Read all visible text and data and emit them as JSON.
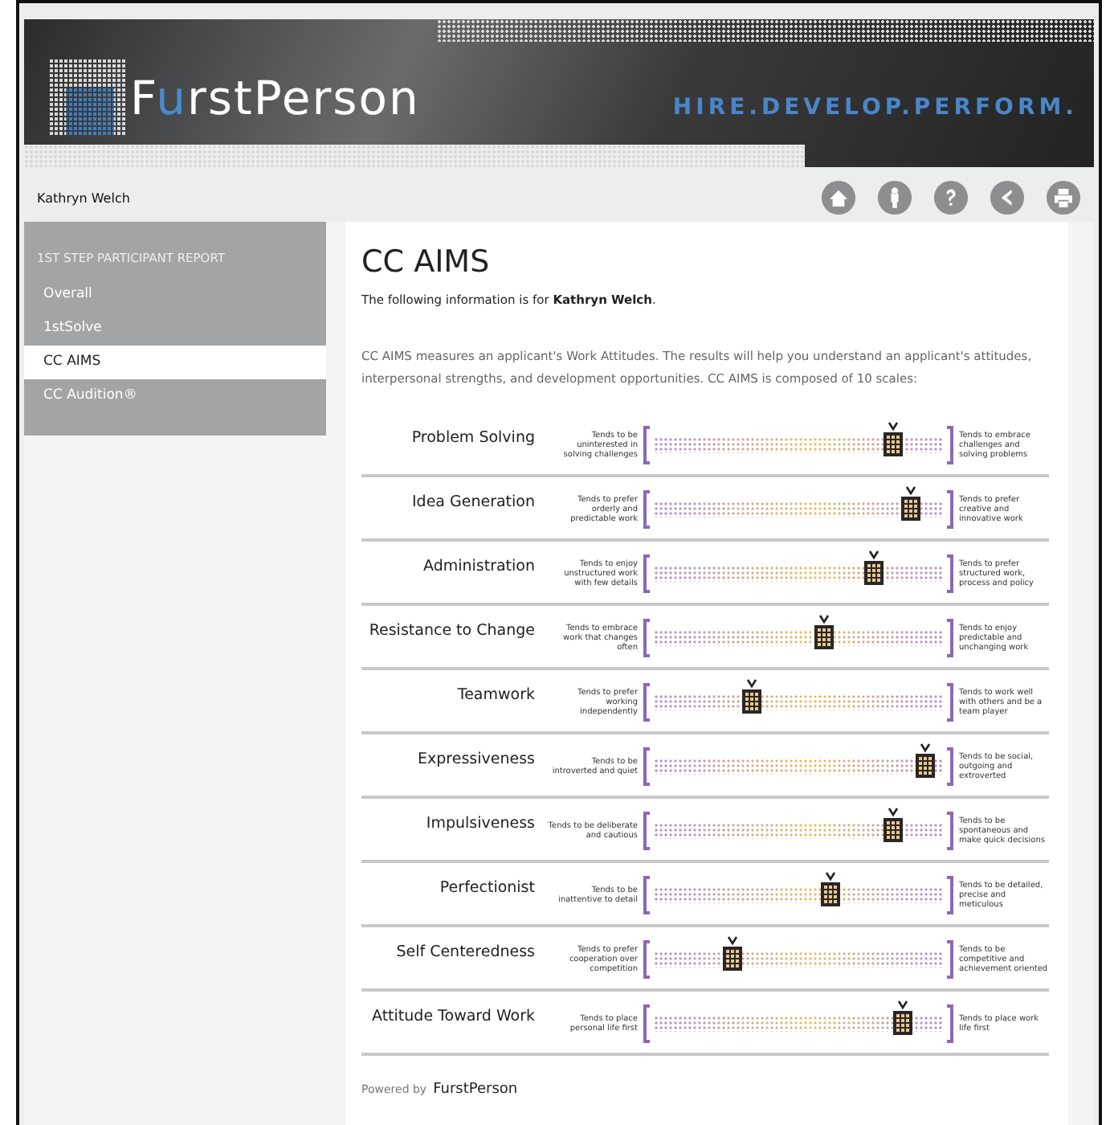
{
  "header": {
    "logo": [
      {
        "text": "F",
        "accent": false
      },
      {
        "text": "u",
        "accent": true
      },
      {
        "text": "rstPerson",
        "accent": false
      }
    ],
    "tagline": "HIRE.DEVELOP.PERFORM."
  },
  "user_bar": {
    "name": "Kathryn Welch",
    "icons": [
      {
        "kind": "home"
      },
      {
        "kind": "person"
      },
      {
        "kind": "help"
      },
      {
        "kind": "back"
      },
      {
        "kind": "print"
      }
    ]
  },
  "sidebar": {
    "heading": "1ST STEP PARTICIPANT REPORT",
    "items": [
      {
        "label": "Overall",
        "selected": false
      },
      {
        "label": "1stSolve",
        "selected": false
      },
      {
        "label": "CC AIMS",
        "selected": true
      },
      {
        "label": "CC Audition®",
        "selected": false
      }
    ]
  },
  "content": {
    "title": "CC AIMS",
    "intro": "The following information is for **Kathryn Welch**.",
    "description": "CC AIMS measures an applicant's Work Attitudes. The results will help you understand an applicant's attitudes, interpersonal strengths, and development opportunities. CC AIMS is composed of 10 scales:",
    "scales": [
      {
        "name": "Problem Solving",
        "low": "Tends to be uninterested in solving challenges",
        "high": "Tends to embrace challenges and solving problems",
        "level": 0.83
      },
      {
        "name": "Idea Generation",
        "low": "Tends to prefer orderly and predictable work",
        "high": "Tends to prefer creative and innovative work",
        "level": 0.89
      },
      {
        "name": "Administration",
        "low": "Tends to enjoy unstructured work with few details",
        "high": "Tends to prefer structured work, process and policy",
        "level": 0.76
      },
      {
        "name": "Resistance to Change",
        "low": "Tends to embrace work that changes often",
        "high": "Tends to enjoy predictable and unchanging work",
        "level": 0.59
      },
      {
        "name": "Teamwork",
        "low": "Tends to prefer working independently",
        "high": "Tends to work well with others and be a team player",
        "level": 0.34
      },
      {
        "name": "Expressiveness",
        "low": "Tends to be introverted and quiet",
        "high": "Tends to be social, outgoing and extroverted",
        "level": 0.94
      },
      {
        "name": "Impulsiveness",
        "low": "Tends to be deliberate and cautious",
        "high": "Tends to be spontaneous and make quick decisions",
        "level": 0.83
      },
      {
        "name": "Perfectionist",
        "low": "Tends to be inattentive to detail",
        "high": "Tends to be detailed, precise and meticulous",
        "level": 0.61
      },
      {
        "name": "Self Centeredness",
        "low": "Tends to prefer cooperation over competition",
        "high": "Tends to be competitive and achievement oriented",
        "level": 0.27
      },
      {
        "name": "Attitude Toward Work",
        "low": "Tends to place personal life first",
        "high": "Tends to place work life first",
        "level": 0.86
      }
    ],
    "footer": {
      "prefix": "Powered by",
      "brand": "FurstPerson"
    }
  }
}
